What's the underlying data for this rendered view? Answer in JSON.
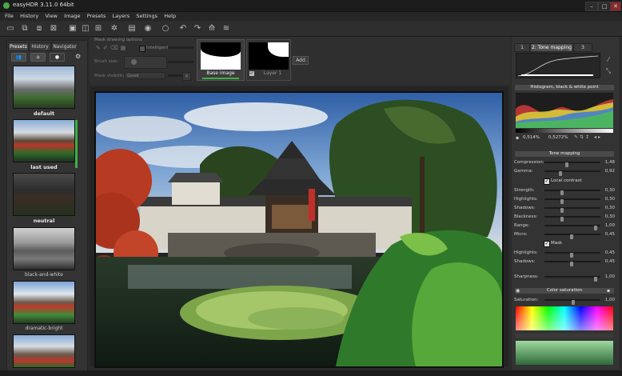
{
  "window": {
    "title": "easyHDR 3.11.0 64bit",
    "minimize": "–",
    "maximize": "□",
    "close": "✕"
  },
  "menu": [
    "File",
    "History",
    "View",
    "Image",
    "Presets",
    "Layers",
    "Settings",
    "Help"
  ],
  "toolbar_icons": [
    "open-icon",
    "batch-icon",
    "reload-icon",
    "close-image-icon",
    "save-icon",
    "save-as-icon",
    "save-all-icon",
    "settings-icon",
    "print-icon",
    "zoom-icon",
    "stop-icon",
    "undo-icon",
    "redo-icon",
    "crop-icon",
    "layers-icon"
  ],
  "left_panel": {
    "tabs": [
      "Presets",
      "History",
      "Navigator"
    ],
    "presets": [
      {
        "label": "default"
      },
      {
        "label": "last used"
      },
      {
        "label": "neutral"
      },
      {
        "label": "black-and-white"
      },
      {
        "label": "dramatic-bright"
      },
      {
        "label": ""
      }
    ]
  },
  "masks": {
    "title": "Mask drawing options",
    "checkbox_label": "Intelligent",
    "brush_size_label": "Brush size:",
    "mask_visibility_label": "Mask visibility:",
    "mask_visibility_value": "Good",
    "layers": [
      {
        "label": "Base image"
      },
      {
        "label": "Layer 1"
      }
    ],
    "add_label": "Add"
  },
  "right_panel": {
    "tabs": [
      "1",
      "2: Tone mapping",
      "3"
    ],
    "histogram_title": "Histogram, black & white point",
    "histogram_left_value": "0,514%",
    "histogram_right_value": "0,5272%",
    "tone_mapping_title": "Tone mapping",
    "sliders_top": [
      {
        "label": "Compression:",
        "value": "1,48"
      },
      {
        "label": "Gamma:",
        "value": "0,92"
      }
    ],
    "local_contrast_label": "Local contrast",
    "sliders_mid": [
      {
        "label": "Strength:",
        "value": "0,30"
      },
      {
        "label": "Highlights:",
        "value": "0,30"
      },
      {
        "label": "Shadows:",
        "value": "0,30"
      },
      {
        "label": "Blackness:",
        "value": "0,30"
      },
      {
        "label": "Range:",
        "value": "1,00"
      },
      {
        "label": "Micro:",
        "value": "0,45"
      }
    ],
    "mask_label": "Mask",
    "sliders_mask": [
      {
        "label": "Highlights:",
        "value": "0,45"
      },
      {
        "label": "Shadows:",
        "value": "0,45"
      }
    ],
    "sharpness": {
      "label": "Sharpness:",
      "value": "1,00"
    },
    "color_saturation_title": "Color saturation",
    "saturation": {
      "label": "Saturation:",
      "value": "1,00"
    }
  },
  "colors": {
    "accent_green": "#3fae49",
    "panel": "#333333",
    "background": "#2b2b2b"
  }
}
